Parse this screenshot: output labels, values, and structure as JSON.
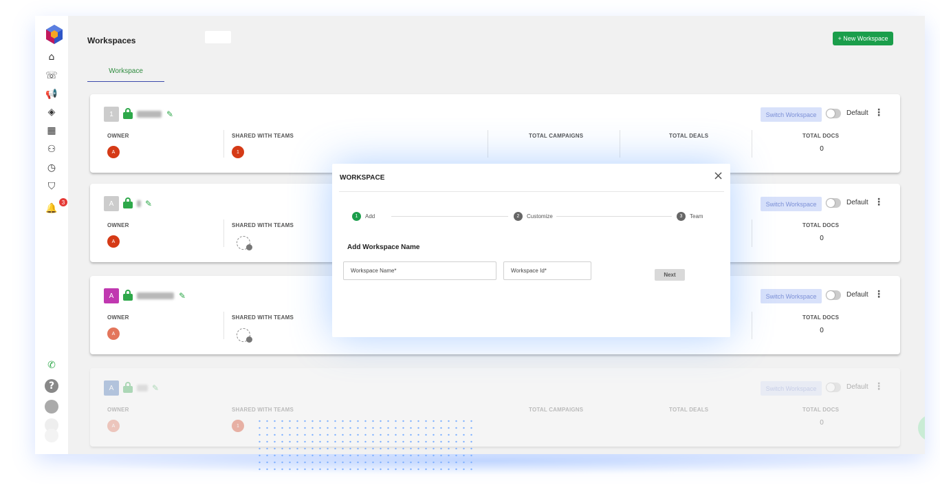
{
  "header": {
    "title": "Workspaces",
    "new_workspace_label": "+ New Workspace"
  },
  "tabs": [
    {
      "label": "Workspace"
    }
  ],
  "sidebar": {
    "icons": [
      "home-icon",
      "phone-list-icon",
      "megaphone-icon",
      "tag-icon",
      "apps-grid-icon",
      "team-icon",
      "clock-icon",
      "shield-icon",
      "bell-icon",
      "phone-icon",
      "help-icon",
      "user-avatar-icon"
    ],
    "notification_count": "3"
  },
  "columns": {
    "owner": "OWNER",
    "shared": "SHARED WITH TEAMS",
    "campaigns": "TOTAL CAMPAIGNS",
    "deals": "TOTAL DEALS",
    "docs": "TOTAL DOCS"
  },
  "cards": [
    {
      "initial": "1",
      "name": "122323",
      "owner_initial": "A",
      "team_initial": "1",
      "docs": "0",
      "switch_label": "Switch Workspace",
      "default_label": "Default"
    },
    {
      "initial": "A",
      "name": "a",
      "owner_initial": "A",
      "team_initial": "",
      "docs": "0",
      "switch_label": "Switch Workspace",
      "default_label": "Default"
    },
    {
      "initial": "A",
      "name": "aaaaaaaaa",
      "owner_initial": "A",
      "team_initial": "",
      "docs": "0",
      "switch_label": "Switch Workspace",
      "default_label": "Default"
    },
    {
      "initial": "A",
      "name": "abl",
      "owner_initial": "A",
      "team_initial": "1",
      "docs": "0",
      "switch_label": "Switch Workspace",
      "default_label": "Default"
    }
  ],
  "modal": {
    "title": "WORKSPACE",
    "steps": [
      {
        "num": "1",
        "label": "Add"
      },
      {
        "num": "2",
        "label": "Customize"
      },
      {
        "num": "3",
        "label": "Team"
      }
    ],
    "section_title": "Add Workspace Name",
    "name_placeholder": "Workspace Name*",
    "id_placeholder": "Workspace Id*",
    "next_label": "Next"
  },
  "colors": {
    "accent_green": "#1b9e4b",
    "owner_red": "#d53a16",
    "switch_bg": "#d8e1fa",
    "step_active": "#1b9e4b",
    "step_inactive": "#666666"
  }
}
